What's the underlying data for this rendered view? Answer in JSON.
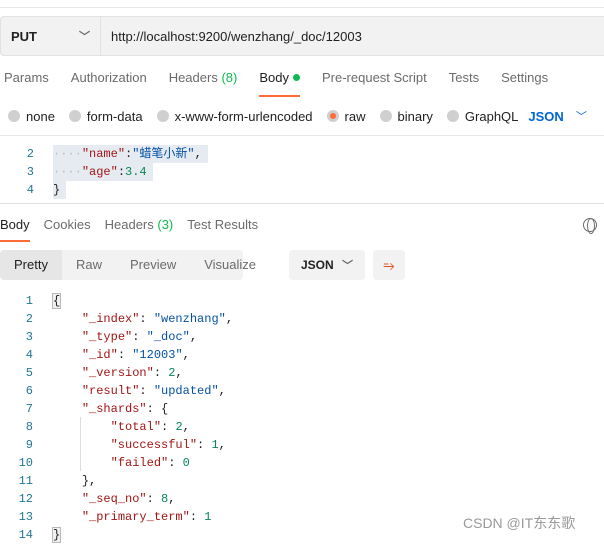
{
  "request": {
    "method": "PUT",
    "url": "http://localhost:9200/wenzhang/_doc/12003"
  },
  "tabs": [
    {
      "label": "Params"
    },
    {
      "label": "Authorization"
    },
    {
      "label": "Headers",
      "count": "(8)"
    },
    {
      "label": "Body",
      "active": true
    },
    {
      "label": "Pre-request Script"
    },
    {
      "label": "Tests"
    },
    {
      "label": "Settings"
    }
  ],
  "body_types": [
    {
      "label": "none"
    },
    {
      "label": "form-data"
    },
    {
      "label": "x-www-form-urlencoded"
    },
    {
      "label": "raw",
      "selected": true
    },
    {
      "label": "binary"
    },
    {
      "label": "GraphQL"
    }
  ],
  "body_format": "JSON",
  "editor": {
    "lines": [
      {
        "n": "2",
        "ws": "····",
        "tokens": [
          {
            "t": "\"name\"",
            "c": "k"
          },
          {
            "t": ":",
            "c": "p"
          },
          {
            "t": "\"蜡笔小新\"",
            "c": "s"
          },
          {
            "t": ",",
            "c": "p"
          }
        ]
      },
      {
        "n": "3",
        "ws": "····",
        "tokens": [
          {
            "t": "\"age\"",
            "c": "k"
          },
          {
            "t": ":",
            "c": "p"
          },
          {
            "t": "3.4",
            "c": "n"
          }
        ]
      },
      {
        "n": "4",
        "ws": "",
        "tokens": [
          {
            "t": "}",
            "c": "p"
          }
        ]
      }
    ]
  },
  "response_tabs": [
    {
      "label": "Body",
      "active": true
    },
    {
      "label": "Cookies"
    },
    {
      "label": "Headers",
      "count": "(3)"
    },
    {
      "label": "Test Results"
    }
  ],
  "view_modes": [
    "Pretty",
    "Raw",
    "Preview",
    "Visualize"
  ],
  "response_format": "JSON",
  "response": {
    "lines": [
      {
        "n": "1",
        "i": "",
        "tokens": [
          {
            "t": "{",
            "c": "p"
          }
        ]
      },
      {
        "n": "2",
        "i": "    ",
        "tokens": [
          {
            "t": "\"_index\"",
            "c": "k"
          },
          {
            "t": ": ",
            "c": "p"
          },
          {
            "t": "\"wenzhang\"",
            "c": "s"
          },
          {
            "t": ",",
            "c": "p"
          }
        ]
      },
      {
        "n": "3",
        "i": "    ",
        "tokens": [
          {
            "t": "\"_type\"",
            "c": "k"
          },
          {
            "t": ": ",
            "c": "p"
          },
          {
            "t": "\"_doc\"",
            "c": "s"
          },
          {
            "t": ",",
            "c": "p"
          }
        ]
      },
      {
        "n": "4",
        "i": "    ",
        "tokens": [
          {
            "t": "\"_id\"",
            "c": "k"
          },
          {
            "t": ": ",
            "c": "p"
          },
          {
            "t": "\"12003\"",
            "c": "s"
          },
          {
            "t": ",",
            "c": "p"
          }
        ]
      },
      {
        "n": "5",
        "i": "    ",
        "tokens": [
          {
            "t": "\"_version\"",
            "c": "k"
          },
          {
            "t": ": ",
            "c": "p"
          },
          {
            "t": "2",
            "c": "n"
          },
          {
            "t": ",",
            "c": "p"
          }
        ]
      },
      {
        "n": "6",
        "i": "    ",
        "tokens": [
          {
            "t": "\"result\"",
            "c": "k"
          },
          {
            "t": ": ",
            "c": "p"
          },
          {
            "t": "\"updated\"",
            "c": "s"
          },
          {
            "t": ",",
            "c": "p"
          }
        ]
      },
      {
        "n": "7",
        "i": "    ",
        "tokens": [
          {
            "t": "\"_shards\"",
            "c": "k"
          },
          {
            "t": ": {",
            "c": "p"
          }
        ]
      },
      {
        "n": "8",
        "i": "        ",
        "tokens": [
          {
            "t": "\"total\"",
            "c": "k"
          },
          {
            "t": ": ",
            "c": "p"
          },
          {
            "t": "2",
            "c": "n"
          },
          {
            "t": ",",
            "c": "p"
          }
        ]
      },
      {
        "n": "9",
        "i": "        ",
        "tokens": [
          {
            "t": "\"successful\"",
            "c": "k"
          },
          {
            "t": ": ",
            "c": "p"
          },
          {
            "t": "1",
            "c": "n"
          },
          {
            "t": ",",
            "c": "p"
          }
        ]
      },
      {
        "n": "10",
        "i": "        ",
        "tokens": [
          {
            "t": "\"failed\"",
            "c": "k"
          },
          {
            "t": ": ",
            "c": "p"
          },
          {
            "t": "0",
            "c": "n"
          }
        ]
      },
      {
        "n": "11",
        "i": "    ",
        "tokens": [
          {
            "t": "},",
            "c": "p"
          }
        ]
      },
      {
        "n": "12",
        "i": "    ",
        "tokens": [
          {
            "t": "\"_seq_no\"",
            "c": "k"
          },
          {
            "t": ": ",
            "c": "p"
          },
          {
            "t": "8",
            "c": "n"
          },
          {
            "t": ",",
            "c": "p"
          }
        ]
      },
      {
        "n": "13",
        "i": "    ",
        "tokens": [
          {
            "t": "\"_primary_term\"",
            "c": "k"
          },
          {
            "t": ": ",
            "c": "p"
          },
          {
            "t": "1",
            "c": "n"
          }
        ]
      },
      {
        "n": "14",
        "i": "",
        "tokens": [
          {
            "t": "}",
            "c": "p"
          }
        ]
      }
    ]
  },
  "watermark": "CSDN @IT东东歌",
  "colors": {
    "accent": "#ff6c37",
    "success": "#0cbb52",
    "link": "#0265d2"
  }
}
